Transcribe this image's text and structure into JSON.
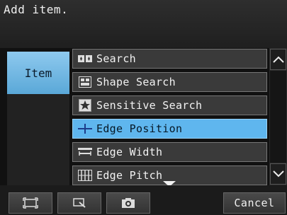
{
  "title": "Add item.",
  "tab": {
    "label": "Item"
  },
  "items": [
    {
      "label": "Search",
      "icon": "search-icon"
    },
    {
      "label": "Shape Search",
      "icon": "shape-search-icon"
    },
    {
      "label": "Sensitive Search",
      "icon": "sensitive-search-icon"
    },
    {
      "label": "Edge Position",
      "icon": "edge-position-icon",
      "selected": true
    },
    {
      "label": "Edge Width",
      "icon": "edge-width-icon"
    },
    {
      "label": "Edge Pitch",
      "icon": "edge-pitch-icon"
    }
  ],
  "footer": {
    "cancel_label": "Cancel"
  },
  "colors": {
    "selected": "#5fb6ee",
    "tab": "#6cb4e2"
  }
}
